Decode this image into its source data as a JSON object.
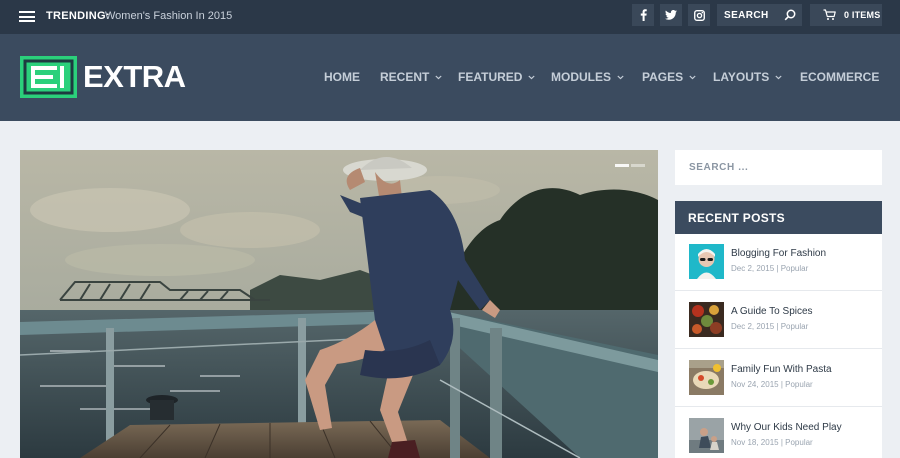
{
  "topbar": {
    "trending_label": "TRENDING:",
    "trending_link": "Women's Fashion In 2015",
    "social": [
      {
        "icon": "facebook-icon",
        "glyph": "f"
      },
      {
        "icon": "twitter-icon",
        "glyph": "t"
      },
      {
        "icon": "instagram-icon",
        "glyph": "ig"
      }
    ],
    "search_placeholder": "SEARCH",
    "cart_label": "0 ITEMS"
  },
  "header": {
    "logo_text": "EXTRA",
    "nav": [
      {
        "label": "HOME",
        "dropdown": false
      },
      {
        "label": "RECENT",
        "dropdown": true
      },
      {
        "label": "FEATURED",
        "dropdown": true
      },
      {
        "label": "MODULES",
        "dropdown": true
      },
      {
        "label": "PAGES",
        "dropdown": true
      },
      {
        "label": "LAYOUTS",
        "dropdown": true
      },
      {
        "label": "ECOMMERCE",
        "dropdown": false
      }
    ]
  },
  "sidebar": {
    "search_placeholder": "SEARCH ...",
    "recent_posts_title": "RECENT POSTS",
    "posts": [
      {
        "title": "Blogging For Fashion",
        "date": "Dec 2, 2015",
        "separator": "|",
        "category": "Popular"
      },
      {
        "title": "A Guide To Spices",
        "date": "Dec 2, 2015",
        "separator": "|",
        "category": "Popular"
      },
      {
        "title": "Family Fun With Pasta",
        "date": "Nov 24, 2015",
        "separator": "|",
        "category": "Popular"
      },
      {
        "title": "Why Our Kids Need Play",
        "date": "Nov 18, 2015",
        "separator": "|",
        "category": "Popular"
      }
    ]
  },
  "colors": {
    "topbar": "#2b3848",
    "header": "#3b4b5f",
    "accent": "#2bd07b",
    "page_bg": "#eceff3"
  }
}
